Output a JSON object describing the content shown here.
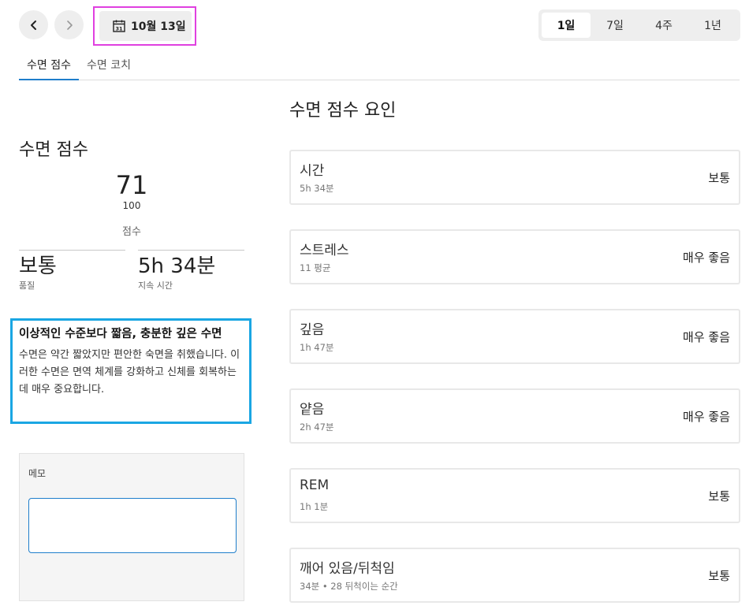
{
  "header": {
    "date_label": "10월 13일",
    "calendar_day": "31",
    "ranges": [
      "1일",
      "7일",
      "4주",
      "1년"
    ],
    "active_range": "1일"
  },
  "tabs": [
    "수면 점수",
    "수면 코치"
  ],
  "score": {
    "title": "수면 점수",
    "value": "71",
    "max": "100",
    "label": "점수"
  },
  "stats": {
    "quality_value": "보통",
    "quality_label": "품질",
    "duration_value": "5h 34분",
    "duration_label": "지속 시간"
  },
  "insight": {
    "title": "이상적인 수준보다 짧음, 충분한 깊은 수면",
    "body": "수면은 약간 짧았지만 편안한 숙면을 취했습니다. 이러한 수면은 면역 체계를 강화하고 신체를 회복하는 데 매우 중요합니다."
  },
  "memo": {
    "label": "메모",
    "value": ""
  },
  "factors": {
    "title": "수면 점수 요인",
    "items": [
      {
        "name": "시간",
        "sub": "5h 34분",
        "rating": "보통"
      },
      {
        "name": "스트레스",
        "sub": "11 평균",
        "rating": "매우 좋음"
      },
      {
        "name": "깊음",
        "sub": "1h 47분",
        "rating": "매우 좋음"
      },
      {
        "name": "얕음",
        "sub": "2h 47분",
        "rating": "매우 좋음"
      },
      {
        "name": "REM",
        "sub": "1h 1분",
        "rating": "보통"
      },
      {
        "name": "깨어 있음/뒤척임",
        "sub": "34분 • 28 뒤척이는 순간",
        "rating": "보통"
      }
    ]
  },
  "colors": {
    "accent": "#1f7ecb",
    "highlight_magenta": "#e040e0",
    "insight_border": "#1aa6e3"
  }
}
